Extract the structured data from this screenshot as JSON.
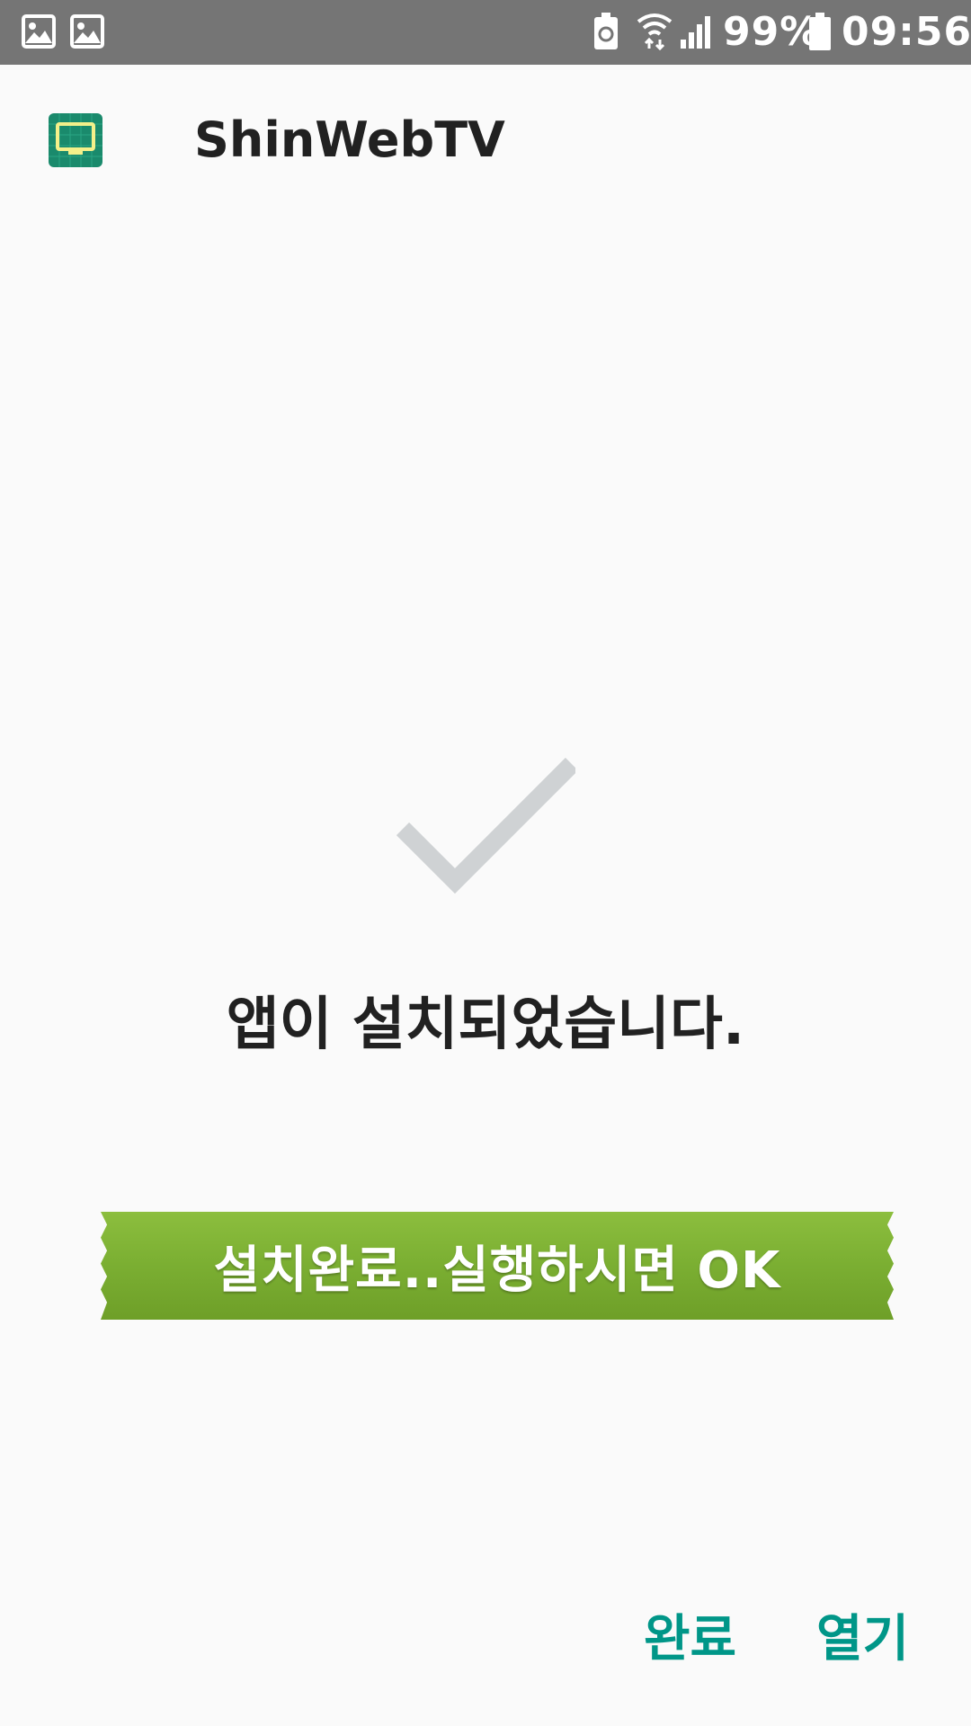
{
  "status_bar": {
    "left_icons": [
      "image-icon",
      "image-icon"
    ],
    "right_icons": [
      "battery-saver-icon",
      "wifi-icon",
      "signal-icon",
      "battery-icon"
    ],
    "battery_percent": "99%",
    "time": "09:56"
  },
  "app": {
    "icon": "tv-icon",
    "name": "ShinWebTV"
  },
  "result": {
    "icon": "checkmark-icon",
    "message": "앱이 설치되었습니다."
  },
  "banner": {
    "text": "설치완료..실행하시면 OK"
  },
  "actions": {
    "done_label": "완료",
    "open_label": "열기"
  },
  "colors": {
    "status_bar": "#757575",
    "background": "#fafafa",
    "accent": "#009688",
    "banner_green": "#7cb033",
    "check_gray": "#cfd2d4"
  }
}
